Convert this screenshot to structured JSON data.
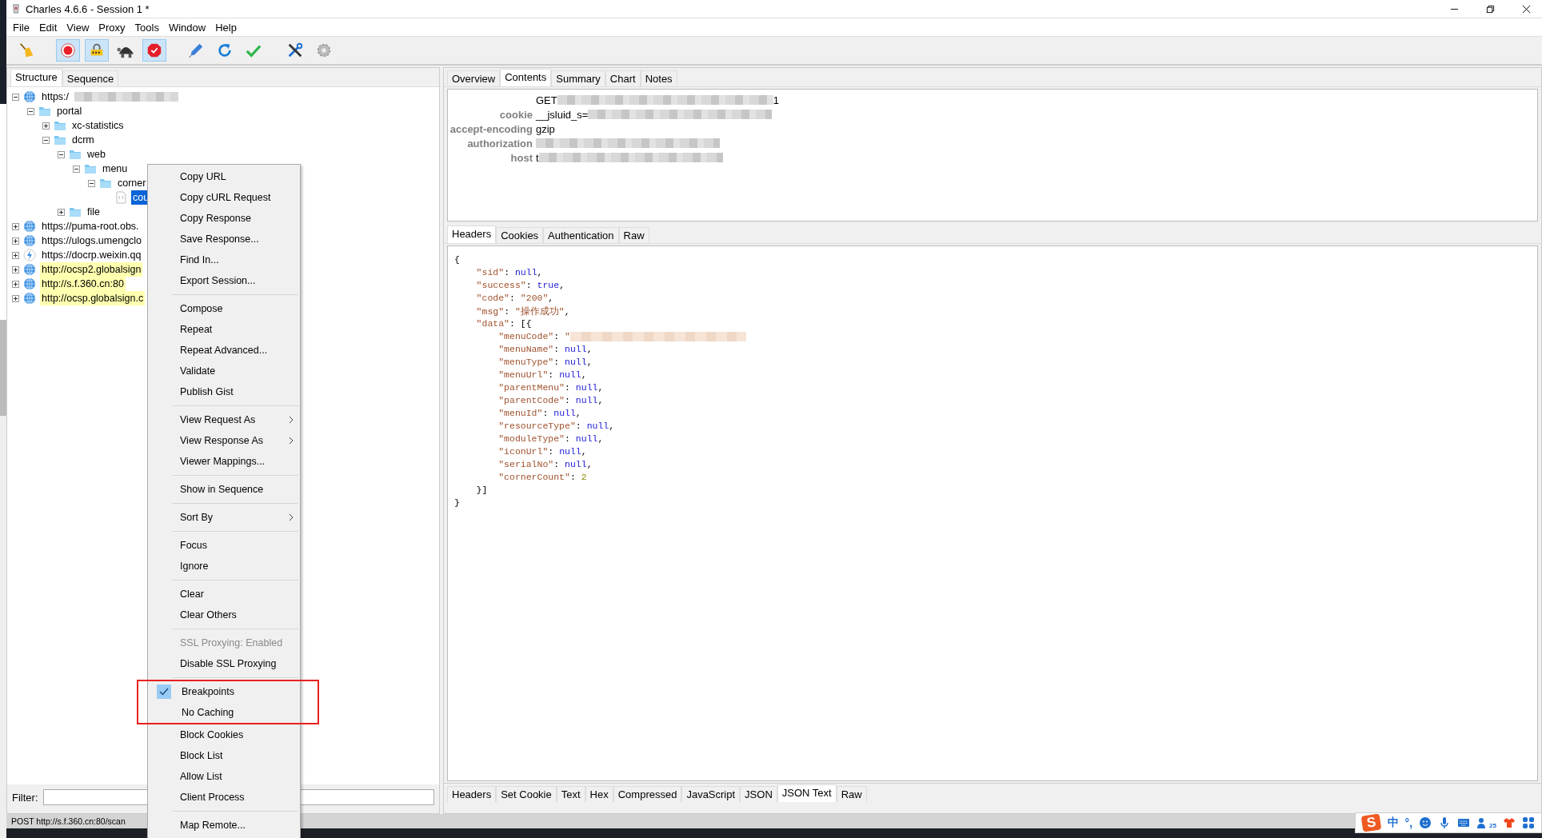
{
  "window": {
    "title": "Charles 4.6.6 - Session 1 *"
  },
  "menubar": [
    "File",
    "Edit",
    "View",
    "Proxy",
    "Tools",
    "Window",
    "Help"
  ],
  "toolbar": [
    [
      {
        "kind": "broom",
        "pressed": false
      }
    ],
    [
      {
        "kind": "record",
        "pressed": true
      },
      {
        "kind": "throttle",
        "pressed": true
      },
      {
        "kind": "turtle",
        "pressed": false
      },
      {
        "kind": "stop",
        "pressed": true
      }
    ],
    [
      {
        "kind": "pen",
        "pressed": false
      },
      {
        "kind": "refresh",
        "pressed": false
      },
      {
        "kind": "check",
        "pressed": false
      }
    ],
    [
      {
        "kind": "tools",
        "pressed": false
      },
      {
        "kind": "gear",
        "pressed": false
      }
    ]
  ],
  "left_tabs": [
    {
      "label": "Structure",
      "selected": true
    },
    {
      "label": "Sequence",
      "selected": false
    }
  ],
  "tree": [
    {
      "label": "https:/",
      "kind": "globe",
      "redacted": true,
      "expanded": true,
      "highlighted": false,
      "selected": false,
      "children": [
        {
          "label": "portal",
          "kind": "folder",
          "expanded": true,
          "highlighted": false,
          "selected": false,
          "children": [
            {
              "label": "xc-statistics",
              "kind": "folder",
              "expanded": false,
              "highlighted": false,
              "selected": false
            },
            {
              "label": "dcrm",
              "kind": "folder",
              "expanded": true,
              "highlighted": false,
              "selected": false,
              "children": [
                {
                  "label": "web",
                  "kind": "folder",
                  "expanded": true,
                  "highlighted": false,
                  "selected": false,
                  "children": [
                    {
                      "label": "menu",
                      "kind": "folder",
                      "expanded": true,
                      "highlighted": false,
                      "selected": false,
                      "children": [
                        {
                          "label": "corner",
                          "kind": "folder",
                          "expanded": true,
                          "highlighted": false,
                          "selected": false,
                          "children": [
                            {
                              "label": "cou",
                              "kind": "file",
                              "highlighted": false,
                              "selected": true
                            }
                          ]
                        }
                      ]
                    }
                  ]
                },
                {
                  "label": "file",
                  "kind": "folder",
                  "expanded": false,
                  "highlighted": false,
                  "selected": false
                }
              ]
            }
          ]
        }
      ]
    },
    {
      "label": "https://puma-root.obs.",
      "kind": "globe",
      "expanded": false,
      "highlighted": false,
      "selected": false
    },
    {
      "label": "https://ulogs.umengclo",
      "kind": "globe",
      "expanded": false,
      "highlighted": false,
      "selected": false
    },
    {
      "label": "https://docrp.weixin.qq",
      "kind": "bolt",
      "expanded": false,
      "highlighted": false,
      "selected": false
    },
    {
      "label": "http://ocsp2.globalsign",
      "kind": "globe",
      "expanded": false,
      "highlighted": true,
      "selected": false
    },
    {
      "label": "http://s.f.360.cn:80",
      "kind": "globe",
      "expanded": false,
      "highlighted": true,
      "selected": false
    },
    {
      "label": "http://ocsp.globalsign.c",
      "kind": "globe",
      "expanded": false,
      "highlighted": true,
      "selected": false
    }
  ],
  "filter": {
    "label": "Filter:"
  },
  "context_menu": [
    [
      {
        "label": "Copy URL",
        "checked": false,
        "disabled": false,
        "submenu": false,
        "annotated": false
      },
      {
        "label": "Copy cURL Request",
        "checked": false,
        "disabled": false,
        "submenu": false,
        "annotated": false
      },
      {
        "label": "Copy Response",
        "checked": false,
        "disabled": false,
        "submenu": false,
        "annotated": false
      },
      {
        "label": "Save Response...",
        "checked": false,
        "disabled": false,
        "submenu": false,
        "annotated": false
      },
      {
        "label": "Find In...",
        "checked": false,
        "disabled": false,
        "submenu": false,
        "annotated": false
      },
      {
        "label": "Export Session...",
        "checked": false,
        "disabled": false,
        "submenu": false,
        "annotated": false
      }
    ],
    [
      {
        "label": "Compose",
        "checked": false,
        "disabled": false,
        "submenu": false,
        "annotated": false
      },
      {
        "label": "Repeat",
        "checked": false,
        "disabled": false,
        "submenu": false,
        "annotated": false
      },
      {
        "label": "Repeat Advanced...",
        "checked": false,
        "disabled": false,
        "submenu": false,
        "annotated": false
      },
      {
        "label": "Validate",
        "checked": false,
        "disabled": false,
        "submenu": false,
        "annotated": false
      },
      {
        "label": "Publish Gist",
        "checked": false,
        "disabled": false,
        "submenu": false,
        "annotated": false
      }
    ],
    [
      {
        "label": "View Request As",
        "checked": false,
        "disabled": false,
        "submenu": true,
        "annotated": false
      },
      {
        "label": "View Response As",
        "checked": false,
        "disabled": false,
        "submenu": true,
        "annotated": false
      },
      {
        "label": "Viewer Mappings...",
        "checked": false,
        "disabled": false,
        "submenu": false,
        "annotated": false
      }
    ],
    [
      {
        "label": "Show in Sequence",
        "checked": false,
        "disabled": false,
        "submenu": false,
        "annotated": false
      }
    ],
    [
      {
        "label": "Sort By",
        "checked": false,
        "disabled": false,
        "submenu": true,
        "annotated": false
      }
    ],
    [
      {
        "label": "Focus",
        "checked": false,
        "disabled": false,
        "submenu": false,
        "annotated": false
      },
      {
        "label": "Ignore",
        "checked": false,
        "disabled": false,
        "submenu": false,
        "annotated": false
      }
    ],
    [
      {
        "label": "Clear",
        "checked": false,
        "disabled": false,
        "submenu": false,
        "annotated": false
      },
      {
        "label": "Clear Others",
        "checked": false,
        "disabled": false,
        "submenu": false,
        "annotated": false
      }
    ],
    [
      {
        "label": "SSL Proxying: Enabled",
        "checked": false,
        "disabled": true,
        "submenu": false,
        "annotated": false
      },
      {
        "label": "Disable SSL Proxying",
        "checked": false,
        "disabled": false,
        "submenu": false,
        "annotated": false
      }
    ],
    [
      {
        "label": "Breakpoints",
        "checked": true,
        "disabled": false,
        "submenu": false,
        "annotated": true
      },
      {
        "label": "No Caching",
        "checked": false,
        "disabled": false,
        "submenu": false,
        "annotated": true
      },
      {
        "label": "Block Cookies",
        "checked": false,
        "disabled": false,
        "submenu": false,
        "annotated": false
      },
      {
        "label": "Block List",
        "checked": false,
        "disabled": false,
        "submenu": false,
        "annotated": false
      },
      {
        "label": "Allow List",
        "checked": false,
        "disabled": false,
        "submenu": false,
        "annotated": false
      },
      {
        "label": "Client Process",
        "checked": false,
        "disabled": false,
        "submenu": false,
        "annotated": false
      }
    ],
    [
      {
        "label": "Map Remote...",
        "checked": false,
        "disabled": false,
        "submenu": false,
        "annotated": false
      }
    ]
  ],
  "right_tabs": [
    {
      "label": "Overview",
      "selected": false
    },
    {
      "label": "Contents",
      "selected": true
    },
    {
      "label": "Summary",
      "selected": false
    },
    {
      "label": "Chart",
      "selected": false
    },
    {
      "label": "Notes",
      "selected": false
    }
  ],
  "request_headers": [
    {
      "value": "GET",
      "redacted": true,
      "suffix": "1"
    },
    {
      "name": "cookie",
      "value": "__jsluid_s=",
      "redacted": true
    },
    {
      "name": "accept-encoding",
      "value": "gzip",
      "redacted": false
    },
    {
      "name": "authorization",
      "redacted": true
    },
    {
      "name": "host",
      "value": "t",
      "redacted": true
    }
  ],
  "request_tabs": [
    {
      "label": "Headers",
      "selected": true
    },
    {
      "label": "Cookies",
      "selected": false
    },
    {
      "label": "Authentication",
      "selected": false
    },
    {
      "label": "Raw",
      "selected": false
    }
  ],
  "response_json": [
    [
      {
        "kind": "punct",
        "text": "{"
      }
    ],
    [
      {
        "kind": "key",
        "text": "    \"sid\""
      },
      {
        "kind": "punct",
        "text": ": "
      },
      {
        "kind": "null",
        "text": "null"
      },
      {
        "kind": "punct",
        "text": ","
      }
    ],
    [
      {
        "kind": "key",
        "text": "    \"success\""
      },
      {
        "kind": "punct",
        "text": ": "
      },
      {
        "kind": "bool",
        "text": "true"
      },
      {
        "kind": "punct",
        "text": ","
      }
    ],
    [
      {
        "kind": "key",
        "text": "    \"code\""
      },
      {
        "kind": "punct",
        "text": ": "
      },
      {
        "kind": "string",
        "text": "\"200\""
      },
      {
        "kind": "punct",
        "text": ","
      }
    ],
    [
      {
        "kind": "key",
        "text": "    \"msg\""
      },
      {
        "kind": "punct",
        "text": ": "
      },
      {
        "kind": "string",
        "text": "\"操作成功\""
      },
      {
        "kind": "punct",
        "text": ","
      }
    ],
    [
      {
        "kind": "key",
        "text": "    \"data\""
      },
      {
        "kind": "punct",
        "text": ": [{"
      }
    ],
    [
      {
        "kind": "key",
        "text": "        \"menuCode\""
      },
      {
        "kind": "punct",
        "text": ": "
      },
      {
        "kind": "string",
        "text": "\""
      },
      {
        "kind": "redacted"
      }
    ],
    [
      {
        "kind": "key",
        "text": "        \"menuName\""
      },
      {
        "kind": "punct",
        "text": ": "
      },
      {
        "kind": "null",
        "text": "null"
      },
      {
        "kind": "punct",
        "text": ","
      }
    ],
    [
      {
        "kind": "key",
        "text": "        \"menuType\""
      },
      {
        "kind": "punct",
        "text": ": "
      },
      {
        "kind": "null",
        "text": "null"
      },
      {
        "kind": "punct",
        "text": ","
      }
    ],
    [
      {
        "kind": "key",
        "text": "        \"menuUrl\""
      },
      {
        "kind": "punct",
        "text": ": "
      },
      {
        "kind": "null",
        "text": "null"
      },
      {
        "kind": "punct",
        "text": ","
      }
    ],
    [
      {
        "kind": "key",
        "text": "        \"parentMenu\""
      },
      {
        "kind": "punct",
        "text": ": "
      },
      {
        "kind": "null",
        "text": "null"
      },
      {
        "kind": "punct",
        "text": ","
      }
    ],
    [
      {
        "kind": "key",
        "text": "        \"parentCode\""
      },
      {
        "kind": "punct",
        "text": ": "
      },
      {
        "kind": "null",
        "text": "null"
      },
      {
        "kind": "punct",
        "text": ","
      }
    ],
    [
      {
        "kind": "key",
        "text": "        \"menuId\""
      },
      {
        "kind": "punct",
        "text": ": "
      },
      {
        "kind": "null",
        "text": "null"
      },
      {
        "kind": "punct",
        "text": ","
      }
    ],
    [
      {
        "kind": "key",
        "text": "        \"resourceType\""
      },
      {
        "kind": "punct",
        "text": ": "
      },
      {
        "kind": "null",
        "text": "null"
      },
      {
        "kind": "punct",
        "text": ","
      }
    ],
    [
      {
        "kind": "key",
        "text": "        \"moduleType\""
      },
      {
        "kind": "punct",
        "text": ": "
      },
      {
        "kind": "null",
        "text": "null"
      },
      {
        "kind": "punct",
        "text": ","
      }
    ],
    [
      {
        "kind": "key",
        "text": "        \"iconUrl\""
      },
      {
        "kind": "punct",
        "text": ": "
      },
      {
        "kind": "null",
        "text": "null"
      },
      {
        "kind": "punct",
        "text": ","
      }
    ],
    [
      {
        "kind": "key",
        "text": "        \"serialNo\""
      },
      {
        "kind": "punct",
        "text": ": "
      },
      {
        "kind": "null",
        "text": "null"
      },
      {
        "kind": "punct",
        "text": ","
      }
    ],
    [
      {
        "kind": "key",
        "text": "        \"cornerCount\""
      },
      {
        "kind": "punct",
        "text": ": "
      },
      {
        "kind": "number",
        "text": "2"
      }
    ],
    [
      {
        "kind": "punct",
        "text": "    }]"
      }
    ],
    [
      {
        "kind": "punct",
        "text": "}"
      }
    ]
  ],
  "response_tabs": [
    {
      "label": "Headers",
      "selected": false
    },
    {
      "label": "Set Cookie",
      "selected": false
    },
    {
      "label": "Text",
      "selected": false
    },
    {
      "label": "Hex",
      "selected": false
    },
    {
      "label": "Compressed",
      "selected": false
    },
    {
      "label": "JavaScript",
      "selected": false
    },
    {
      "label": "JSON",
      "selected": false
    },
    {
      "label": "JSON Text",
      "selected": true
    },
    {
      "label": "Raw",
      "selected": false
    }
  ],
  "status_bar": "POST http://s.f.360.cn:80/scan",
  "ime_bar": {
    "logo": "S",
    "mode": "中",
    "punctuation": "°,",
    "badge": "25"
  }
}
